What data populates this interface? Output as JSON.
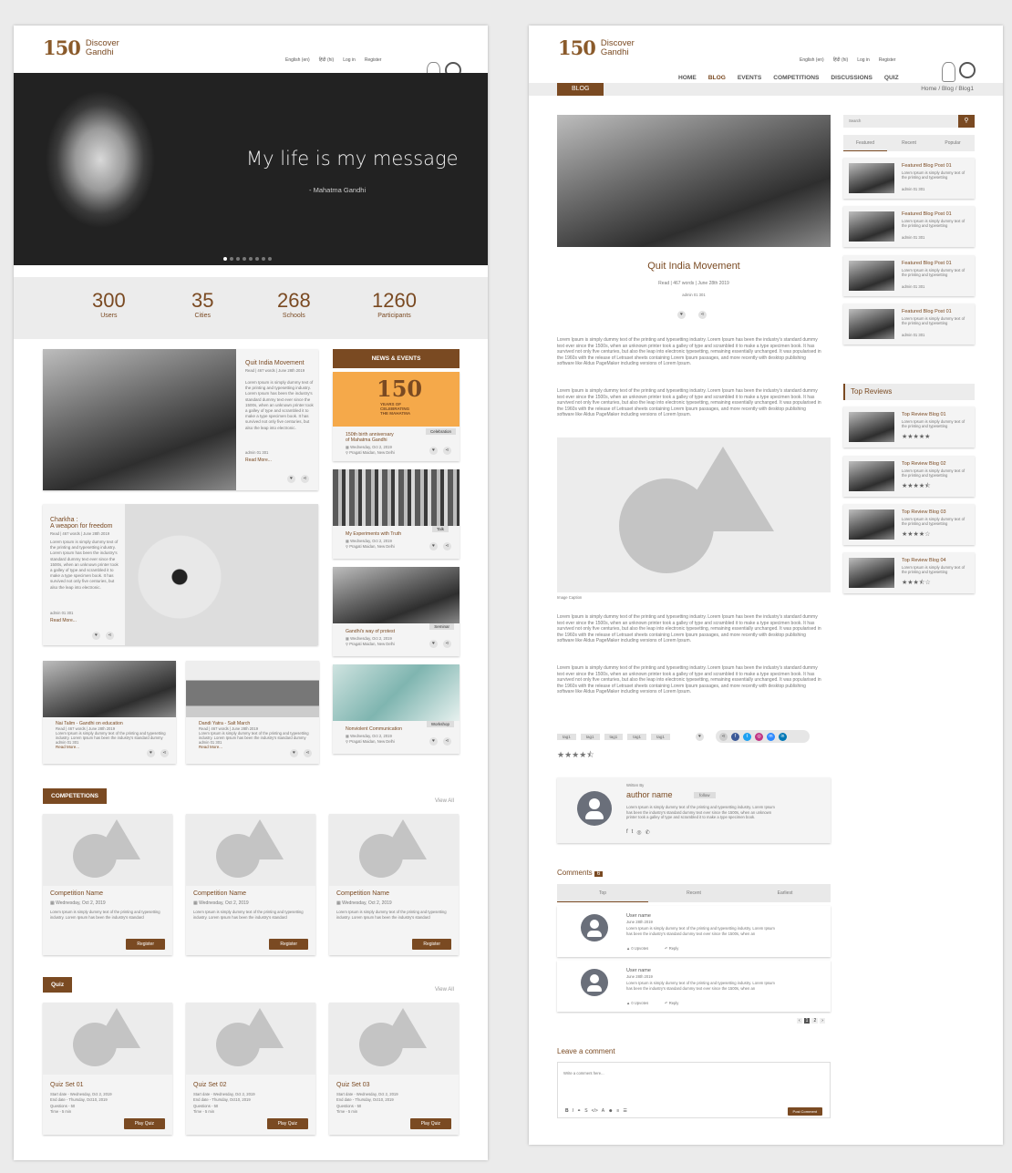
{
  "nav": {
    "lang_en": "English (en)",
    "lang_hi": "हिंदी (hi)",
    "login": "Log in",
    "register": "Register",
    "items": [
      "HOME",
      "BLOG",
      "EVENTS",
      "COMPETITIONS",
      "DISCUSSIONS",
      "QUIZ"
    ]
  },
  "logo": {
    "line1": "Discover",
    "line2": "Gandhi",
    "num": "150"
  },
  "hero": {
    "quote": "My life is my message",
    "author": "- Mahatma Gandhi"
  },
  "stats": [
    {
      "num": "300",
      "label": "Users"
    },
    {
      "num": "35",
      "label": "Cities"
    },
    {
      "num": "268",
      "label": "Schools"
    },
    {
      "num": "1260",
      "label": "Participants"
    }
  ],
  "home": {
    "lorem_short": "Lorem Ipsum is simply dummy text of the printing and typesetting industry. Lorem Ipsum has been the industry's standard dummy text ever since the 1500s, when an unknown printer took a galley of type and scrambled it to make a type specimen book. It has survived not only five centuries, but also the leap into electronic.",
    "post1": {
      "title": "Quit India Movement",
      "meta": "Read | 467 words | June 28th 2019",
      "read": "Read More..."
    },
    "post2": {
      "title1": "Charkha :",
      "title2": "A weapon for freedom",
      "meta": "Read | 467 words | June 28th 2019",
      "read": "Read More..."
    },
    "post3": {
      "title": "Nai Talim - Gandhi on education",
      "meta": "Read | 467 words | June 28th 2019",
      "read": "Read More..."
    },
    "post4": {
      "title": "Dandi Yatra - Salt March",
      "meta": "Read | 467 words | June 28th 2019",
      "read": "Read More..."
    },
    "stat_line": "admin  01  301",
    "news_title": "NEWS & EVENTS",
    "news": [
      {
        "badge": "Celebration",
        "title1": "150th birth anniversary",
        "title2": "of Mahatma Gandhi",
        "date": "Wednesday, Oct 2, 2019",
        "place": "Pragati Maidan, New Delhi"
      },
      {
        "badge": "Talk",
        "title1": "My Experiments with Truth",
        "title2": "",
        "date": "Wednesday, Oct 2, 2019",
        "place": "Pragati Maidan, New Delhi"
      },
      {
        "badge": "Seminar",
        "title1": "Gandhi's way of protest",
        "title2": "",
        "date": "Wednesday, Oct 2, 2019",
        "place": "Pragati Maidan, New Delhi"
      },
      {
        "badge": "Workshop",
        "title1": "Nonviolent Communication",
        "title2": "",
        "date": "Wednesday, Oct 2, 2019",
        "place": "Pragati Maidan, New Delhi"
      }
    ],
    "banner150": {
      "line1": "YEARS OF",
      "line2": "CELEBRATING",
      "line3": "THE MAHATMA"
    },
    "comp_title": "COMPETETIONS",
    "view_all": "View All",
    "comp": {
      "name": "Competition Name",
      "date": "Wednesday, Oct 2, 2019",
      "desc": "Lorem Ipsum is simply dummy text of the printing and typesetting industry. Lorem Ipsum has been the industry's standard",
      "btn": "Register"
    },
    "quiz_title": "Quiz",
    "quiz": [
      {
        "name": "Quiz Set 01"
      },
      {
        "name": "Quiz Set 02"
      },
      {
        "name": "Quiz Set 03"
      }
    ],
    "quiz_start": "Start date - Wednesday, Oct 2, 2019",
    "quiz_end": "End date - Thursday, Oct10, 2019",
    "quiz_q": "Questions - 50",
    "quiz_time": "Time - 5 min",
    "quiz_btn": "Play Quiz"
  },
  "blog": {
    "tag": "BLOG",
    "crumb": "Home  /  Blog  /  Blog1",
    "title": "Quit India Movement",
    "meta": "Read | 467 words | June 28th 2019",
    "stat": "admin  01  301",
    "para": "Lorem Ipsum is simply dummy text of the printing and typesetting industry. Lorem Ipsum has been the industry's standard dummy text ever since the 1500s, when an unknown printer took a galley of type and scrambled it to make a type specimen book. It has survived not only five centuries, but also the leap into electronic typesetting, remaining essentially unchanged. It was popularised in the 1960s with the release of Letraset sheets containing Lorem Ipsum passages, and more recently with desktop publishing software like Aldus PageMaker including versions of Lorem Ipsum.",
    "caption": "Image Caption",
    "tags": [
      "tag1",
      "tag1",
      "tag1",
      "tag1",
      "tag1"
    ],
    "written_by": "Written By",
    "author": "author name",
    "follow": "follow",
    "author_bio": "Lorem Ipsum is simply dummy text of the printing and typesetting industry. Lorem Ipsum has been the industry's standard dummy text ever since the 1500s, when an unknown printer took a galley of type and scrambled it to make a type specimen book.",
    "comments_label": "Comments",
    "comments_count": "6",
    "comment_tabs": [
      "Top",
      "Recent",
      "Earliest"
    ],
    "comments": [
      {
        "user": "User name",
        "date": "June 28th 2019",
        "text": "Lorem Ipsum is simply dummy text of the printing and typesetting industry. Lorem Ipsum has been the industry's standard dummy text ever since the 1500s, when an",
        "upvotes": "0 Upvotes",
        "reply": "Reply"
      },
      {
        "user": "User name",
        "date": "June 28th 2019",
        "text": "Lorem Ipsum is simply dummy text of the printing and typesetting industry. Lorem Ipsum has been the industry's standard dummy text ever since the 1500s, when an",
        "upvotes": "0 Upvotes",
        "reply": "Reply"
      }
    ],
    "pages": [
      "1",
      "2"
    ],
    "leave": "Leave a comment",
    "placeholder": "Write a comment here...",
    "post_btn": "Post Comment",
    "search_ph": "Search",
    "side_tabs": [
      "Featured",
      "Recent",
      "Popular"
    ],
    "featured": {
      "title": "Featured Blog Post 01",
      "desc": "Lorem Ipsum is simply dummy text of the printing and typesetting",
      "stat": "admin  01  301"
    },
    "top_reviews": "Top Reviews",
    "reviews": [
      {
        "title": "Top Review Blog 01",
        "stars": "★★★★★",
        "rating": 5
      },
      {
        "title": "Top Review Blog 02",
        "stars": "★★★★⯪",
        "rating": 4.5
      },
      {
        "title": "Top Review Blog 03",
        "stars": "★★★★☆",
        "rating": 4
      },
      {
        "title": "Top Review Blog 04",
        "stars": "★★★⯪☆",
        "rating": 3.5
      }
    ],
    "review_desc": "Lorem Ipsum is simply dummy text of the printing and typesetting",
    "stars": "★★★★⯪"
  },
  "colors": {
    "brand": "#7a4a22",
    "light": "#f4f4f4"
  },
  "icons": [
    "like-icon",
    "share-icon",
    "comment-icon",
    "eye-icon",
    "calendar-icon",
    "location-icon",
    "search-icon",
    "user-avatar-icon",
    "facebook-icon",
    "twitter-icon",
    "instagram-icon",
    "whatsapp-icon",
    "linkedin-icon"
  ]
}
